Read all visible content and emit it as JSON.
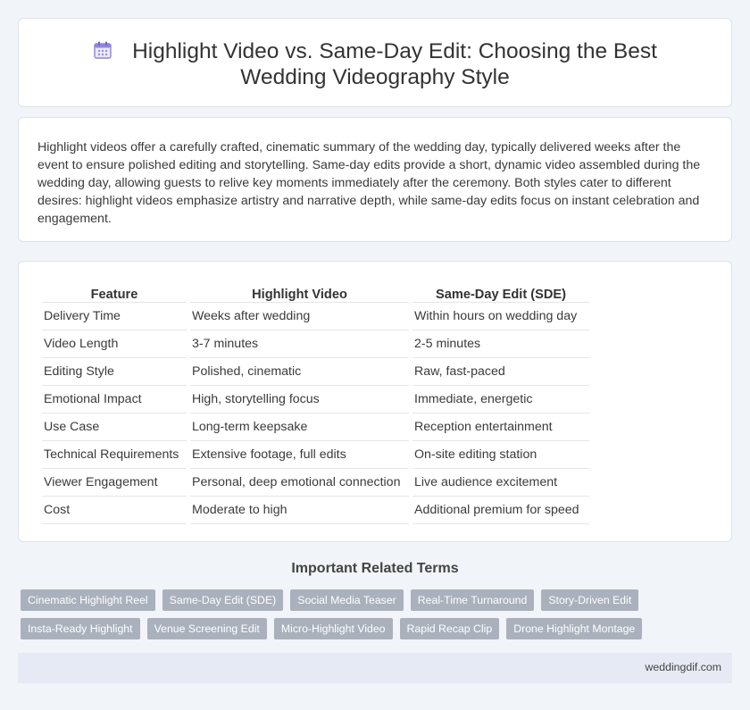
{
  "header": {
    "icon": "calendar-icon",
    "title": "Highlight Video vs. Same-Day Edit: Choosing the Best Wedding Videography Style"
  },
  "intro": {
    "text": "Highlight videos offer a carefully crafted, cinematic summary of the wedding day, typically delivered weeks after the event to ensure polished editing and storytelling. Same-day edits provide a short, dynamic video assembled during the wedding day, allowing guests to relive key moments immediately after the ceremony. Both styles cater to different desires: highlight videos emphasize artistry and narrative depth, while same-day edits focus on instant celebration and engagement."
  },
  "table": {
    "headers": [
      "Feature",
      "Highlight Video",
      "Same-Day Edit (SDE)"
    ],
    "rows": [
      [
        "Delivery Time",
        "Weeks after wedding",
        "Within hours on wedding day"
      ],
      [
        "Video Length",
        "3-7 minutes",
        "2-5 minutes"
      ],
      [
        "Editing Style",
        "Polished, cinematic",
        "Raw, fast-paced"
      ],
      [
        "Emotional Impact",
        "High, storytelling focus",
        "Immediate, energetic"
      ],
      [
        "Use Case",
        "Long-term keepsake",
        "Reception entertainment"
      ],
      [
        "Technical Requirements",
        "Extensive footage, full edits",
        "On-site editing station"
      ],
      [
        "Viewer Engagement",
        "Personal, deep emotional connection",
        "Live audience excitement"
      ],
      [
        "Cost",
        "Moderate to high",
        "Additional premium for speed"
      ]
    ]
  },
  "related": {
    "heading": "Important Related Terms",
    "tags": [
      "Cinematic Highlight Reel",
      "Same-Day Edit (SDE)",
      "Social Media Teaser",
      "Real-Time Turnaround",
      "Story-Driven Edit",
      "Insta-Ready Highlight",
      "Venue Screening Edit",
      "Micro-Highlight Video",
      "Rapid Recap Clip",
      "Drone Highlight Montage"
    ]
  },
  "footer": {
    "site": "weddingdif.com"
  },
  "colors": {
    "background": "#f1f4f9",
    "tag": "#aab1bd",
    "footer": "#e5eaf4",
    "icon_accent": "#7c6fd6"
  }
}
